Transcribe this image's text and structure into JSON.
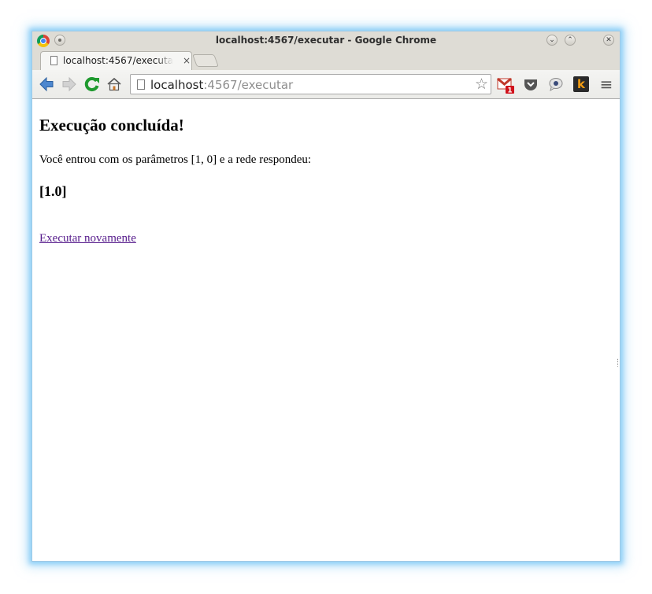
{
  "window": {
    "title": "localhost:4567/executar - Google Chrome",
    "buttons": {
      "minimize": "⌄",
      "maximize": "⌃",
      "close": "✕"
    }
  },
  "tabs": [
    {
      "label": "localhost:4567/executar",
      "close": "×",
      "active": true
    }
  ],
  "toolbar": {
    "url_host": "localhost",
    "url_path": ":4567/executar",
    "bookmark_star": "☆",
    "gmail_badge": "1",
    "ext_k_label": "k",
    "menu_icon": "≡"
  },
  "page": {
    "heading": "Execução concluída!",
    "message": "Você entrou com os parâmetros [1, 0] e a rede respondeu:",
    "result": "[1.0]",
    "link": "Executar novamente"
  },
  "colors": {
    "titlebar": "#dedcd5",
    "link_visited": "#551a8b",
    "window_glow": "#8fd0f7"
  }
}
